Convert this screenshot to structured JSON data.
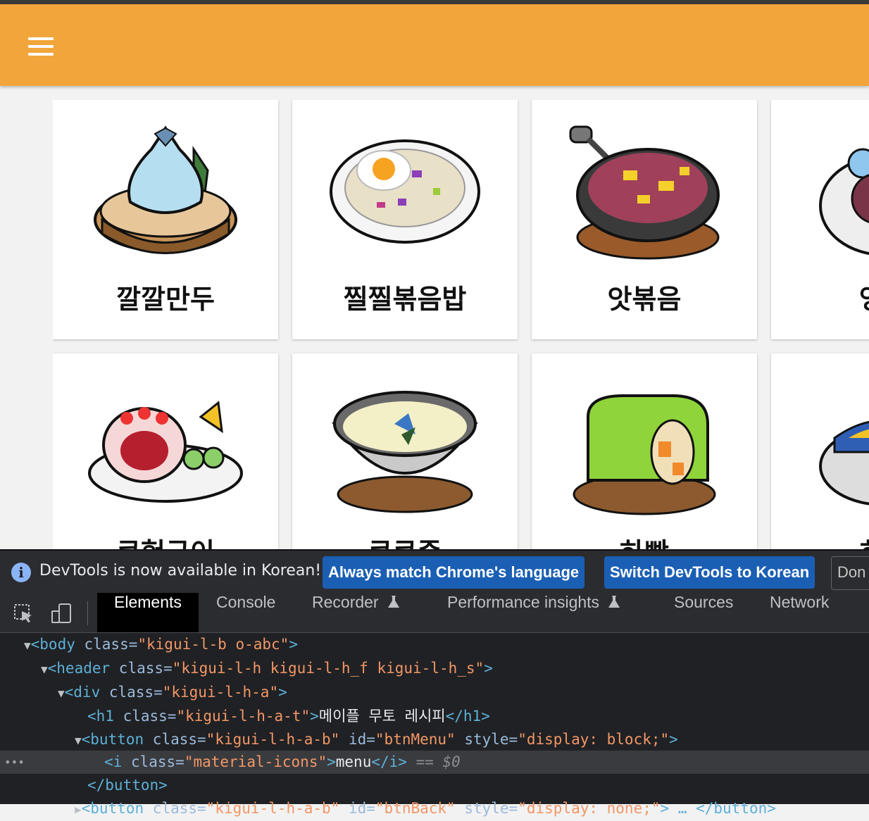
{
  "page": {
    "menu_icon_name": "menu-icon",
    "cards": [
      {
        "name": "깔깔만두"
      },
      {
        "name": "찔찔볶음밥"
      },
      {
        "name": "앗볶음"
      },
      {
        "name": "엉엉"
      },
      {
        "name": "쿠헝구이"
      },
      {
        "name": "쿠쿠죽"
      },
      {
        "name": "하빵"
      },
      {
        "name": "히히"
      }
    ]
  },
  "devtools": {
    "notice": {
      "text": "DevTools is now available in Korean!",
      "button_match": "Always match Chrome's language",
      "button_switch": "Switch DevTools to Korean",
      "button_dont": "Don"
    },
    "tabs": [
      "Elements",
      "Console",
      "Recorder",
      "Performance insights",
      "Sources",
      "Network"
    ],
    "active_tab": "Elements",
    "code": {
      "l1_tag": "<body",
      "l1_attr": " class=",
      "l1_val": "\"kigui-l-b o-abc\"",
      "l1_end": ">",
      "l2_tag": "<header",
      "l2_attr": " class=",
      "l2_val": "\"kigui-l-h kigui-l-h_f kigui-l-h_s\"",
      "l2_end": ">",
      "l3_tag": "<div",
      "l3_attr": " class=",
      "l3_val": "\"kigui-l-h-a\"",
      "l3_end": ">",
      "l4_tag": "<h1",
      "l4_attr": " class=",
      "l4_val": "\"kigui-l-h-a-t\"",
      "l4_end": ">",
      "l4_text": "메이플 무토 레시피",
      "l4_close": "</h1>",
      "l5_tag": "<button",
      "l5_attr1": " class=",
      "l5_val1": "\"kigui-l-h-a-b\"",
      "l5_attr2": " id=",
      "l5_val2": "\"btnMenu\"",
      "l5_attr3": " style=",
      "l5_val3": "\"display: block;\"",
      "l5_end": ">",
      "l6_tag": "<i",
      "l6_attr": " class=",
      "l6_val": "\"material-icons\"",
      "l6_end": ">",
      "l6_text": "menu",
      "l6_close": "</i>",
      "l6_eq": " == $0",
      "l7_close": "</button>",
      "l8_tag": "<button",
      "l8_attr1": " class=",
      "l8_val1": "\"kigui-l-h-a-b\"",
      "l8_attr2": " id=",
      "l8_val2": "\"btnBack\"",
      "l8_attr3": " style=",
      "l8_val3": "\"display: none;\"",
      "l8_end": ">",
      "l8_rest": " … </button>"
    }
  }
}
